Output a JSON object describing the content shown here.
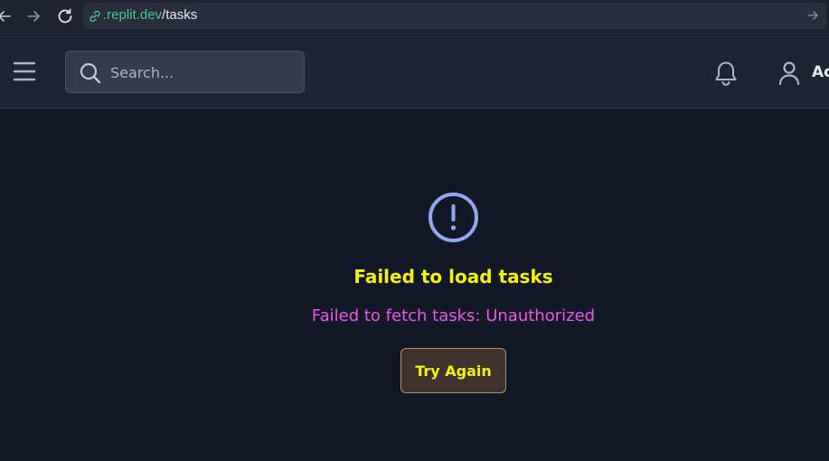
{
  "browser": {
    "url_domain": ".replit.dev",
    "url_path": "/tasks"
  },
  "header": {
    "search_placeholder": "Search...",
    "user_name": "Ac"
  },
  "error": {
    "title": "Failed to load tasks",
    "message": "Failed to fetch tasks: Unauthorized",
    "retry_label": "Try Again"
  },
  "colors": {
    "background": "#131827",
    "header_bg": "#1e2433",
    "title": "#f5f50a",
    "message": "#ee55ee",
    "icon_accent": "#8fa8f0",
    "url_domain": "#4fc58a"
  }
}
